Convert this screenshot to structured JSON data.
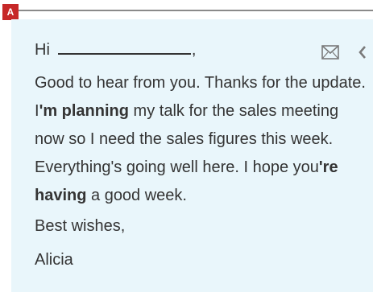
{
  "label": "A",
  "email": {
    "greeting_prefix": "Hi",
    "greeting_suffix": ",",
    "body_segments": [
      "Good to hear from you. Thanks for the update. I",
      "'m planning",
      " my talk for the sales meeting now so I need the sales figures this week. Everything's going well here. I hope you",
      "'re having",
      " a good week."
    ],
    "signoff": "Best wishes,",
    "signature": "Alicia"
  },
  "icons": {
    "email": "envelope-icon",
    "back": "back-icon"
  },
  "colors": {
    "label_bg": "#c62828",
    "card_bg": "#e9f6fb",
    "text": "#343434"
  }
}
